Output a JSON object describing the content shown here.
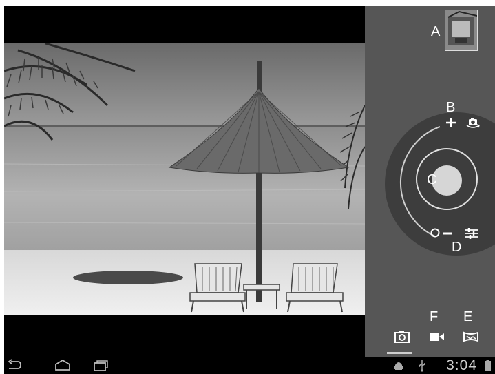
{
  "labels": {
    "a": "A",
    "b": "B",
    "c": "C",
    "d": "D",
    "e": "E",
    "f": "F"
  },
  "status": {
    "time": "3:04"
  },
  "icons": {
    "back": "back-arrow-icon",
    "home": "home-icon",
    "recent": "recent-apps-icon",
    "android": "android-debug-icon",
    "usb": "usb-icon",
    "battery": "battery-icon",
    "camera_mode": "camera-icon",
    "video_mode": "video-camera-icon",
    "panorama_mode": "panorama-icon",
    "zoom_in": "plus-icon",
    "zoom_out": "minus-icon",
    "switch_camera": "switch-camera-icon",
    "settings": "settings-sliders-icon"
  },
  "colors": {
    "panel": "#565656",
    "dial": "#3d3d3d",
    "shutter": "#d6d6d6"
  }
}
